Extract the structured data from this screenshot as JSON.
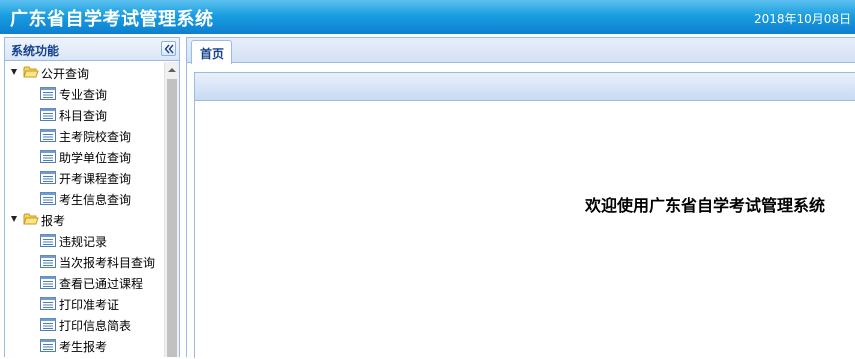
{
  "header": {
    "title": "广东省自学考试管理系统",
    "date": "2018年10月08日"
  },
  "sidebar": {
    "title": "系统功能",
    "collapse_icon": "double-chevron-left-icon",
    "groups": [
      {
        "label": "公开查询",
        "icon": "folder-icon",
        "expanded": true,
        "items": [
          {
            "label": "专业查询"
          },
          {
            "label": "科目查询"
          },
          {
            "label": "主考院校查询"
          },
          {
            "label": "助学单位查询"
          },
          {
            "label": "开考课程查询"
          },
          {
            "label": "考生信息查询"
          }
        ]
      },
      {
        "label": "报考",
        "icon": "folder-icon",
        "expanded": true,
        "items": [
          {
            "label": "违规记录"
          },
          {
            "label": "当次报考科目查询"
          },
          {
            "label": "查看已通过课程"
          },
          {
            "label": "打印准考证"
          },
          {
            "label": "打印信息简表"
          },
          {
            "label": "考生报考"
          }
        ]
      }
    ]
  },
  "tabs": [
    {
      "label": "首页",
      "active": true
    }
  ],
  "main": {
    "welcome": "欢迎使用广东省自学考试管理系统"
  },
  "colors": {
    "header_top": "#5cc0ef",
    "header_bottom": "#0d7fd0",
    "panel_border": "#99bbe8",
    "panel_title": "#15428b"
  }
}
